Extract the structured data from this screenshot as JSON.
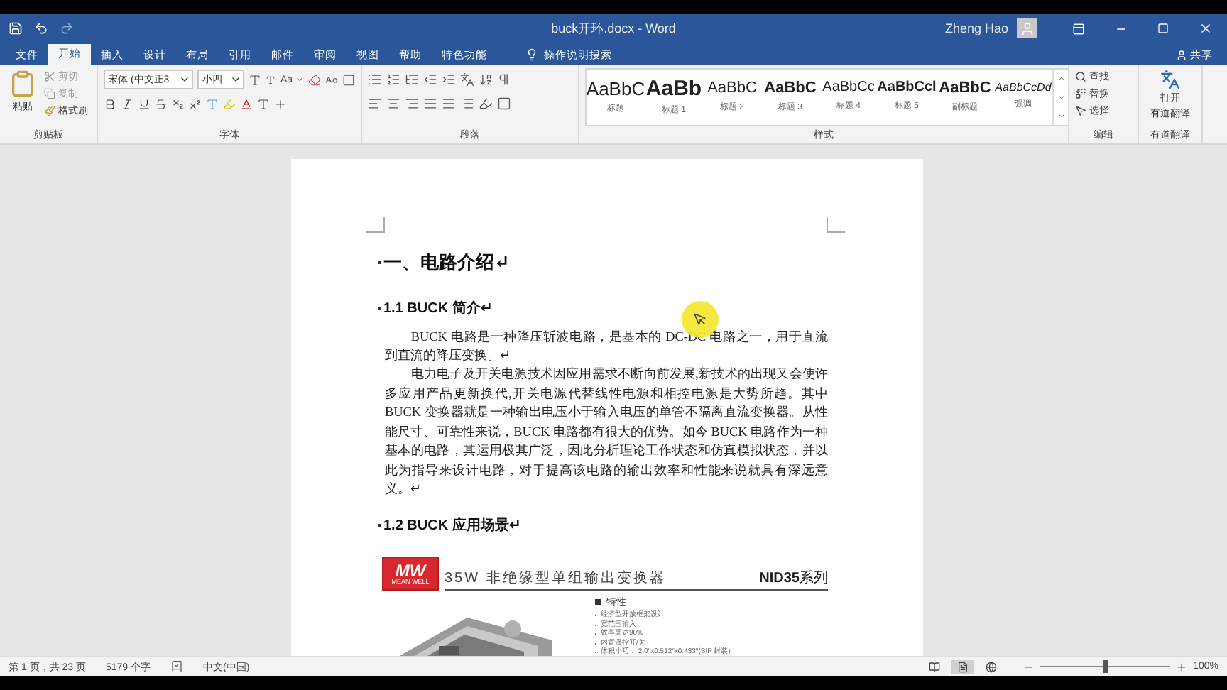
{
  "title_bar": {
    "document_title": "buck开环.docx - Word",
    "user": "Zheng Hao"
  },
  "tabs": [
    {
      "label": "文件",
      "selected": false
    },
    {
      "label": "开始",
      "selected": true
    },
    {
      "label": "插入",
      "selected": false
    },
    {
      "label": "设计",
      "selected": false
    },
    {
      "label": "布局",
      "selected": false
    },
    {
      "label": "引用",
      "selected": false
    },
    {
      "label": "邮件",
      "selected": false
    },
    {
      "label": "审阅",
      "selected": false
    },
    {
      "label": "视图",
      "selected": false
    },
    {
      "label": "帮助",
      "selected": false
    },
    {
      "label": "特色功能",
      "selected": false
    }
  ],
  "tell_me": "操作说明搜索",
  "share": "共享",
  "ribbon": {
    "clipboard": {
      "paste": "粘贴",
      "cut": "剪切",
      "copy": "复制",
      "format_painter": "格式刷",
      "label": "剪贴板"
    },
    "font": {
      "name": "宋体 (中文正3",
      "size": "小四",
      "case": "Aa",
      "label": "字体"
    },
    "paragraph": {
      "label": "段落"
    },
    "styles": {
      "label": "样式",
      "items": [
        {
          "preview": "AaBbC",
          "name": "标题",
          "kind": "title"
        },
        {
          "preview": "AaBb",
          "name": "标题 1",
          "kind": "heading1"
        },
        {
          "preview": "AaBbC",
          "name": "标题 2",
          "kind": "heading2"
        },
        {
          "preview": "AaBbC",
          "name": "标题 3",
          "kind": "heading3"
        },
        {
          "preview": "AaBbCc",
          "name": "标题 4",
          "kind": "heading4"
        },
        {
          "preview": "AaBbCcl",
          "name": "标题 5",
          "kind": "heading5"
        },
        {
          "preview": "AaBbC",
          "name": "副标题",
          "kind": "subtitle"
        },
        {
          "preview": "AaBbCcDd",
          "name": "强调",
          "kind": "emphasis"
        }
      ]
    },
    "editing": {
      "find": "查找",
      "replace": "替换",
      "select": "选择",
      "label": "编辑"
    },
    "translate": {
      "button": [
        "打开",
        "有道翻译"
      ],
      "label": "有道翻译"
    }
  },
  "document": {
    "blocks": [
      {
        "kind": "heading1",
        "text": "一、电路介绍↵"
      },
      {
        "kind": "heading2",
        "text": "1.1 BUCK 简介↵"
      },
      {
        "kind": "paragraph",
        "text": "BUCK 电路是一种降压斩波电路，是基本的 DC-DC 电路之一，用于直流到直流的降压变换。↵"
      },
      {
        "kind": "paragraph",
        "text": "电力电子及开关电源技术因应用需求不断向前发展,新技术的出现又会使许多应用产品更新换代,开关电源代替线性电源和相控电源是大势所趋。其中 BUCK 变换器就是一种输出电压小于输入电压的单管不隔离直流变换器。从性能尺寸、可靠性来说，BUCK 电路都有很大的优势。如今 BUCK 电路作为一种基本的电路，其运用极其广泛，因此分析理论工作状态和仿真模拟状态，并以此为指导来设计电路，对于提高该电路的输出效率和性能来说就具有深远意义。↵"
      },
      {
        "kind": "heading2",
        "text": "1.2 BUCK 应用场景↵"
      }
    ],
    "datasheet": {
      "logo": [
        "MW",
        "MEAN WELL"
      ],
      "title": "35W 非绝缘型单组输出变换器",
      "series": "**NID35**系列",
      "features_heading": "特性",
      "features": [
        "经济型开放框架设计",
        "宽范围输入",
        "效率高达90%",
        "内置遥控开/关",
        "体积小巧： 2.0\"x0.512\"x0.433\"(SIP 封装)"
      ]
    }
  },
  "status_bar": {
    "page": "第 1 页，共 23 页",
    "words": "5179 个字",
    "language": "中文(中国)",
    "views": [
      {
        "kind": "read",
        "selected": false
      },
      {
        "kind": "print",
        "selected": true
      },
      {
        "kind": "web",
        "selected": false
      }
    ],
    "zoom": {
      "level": 0.5,
      "reading": "100%"
    }
  }
}
